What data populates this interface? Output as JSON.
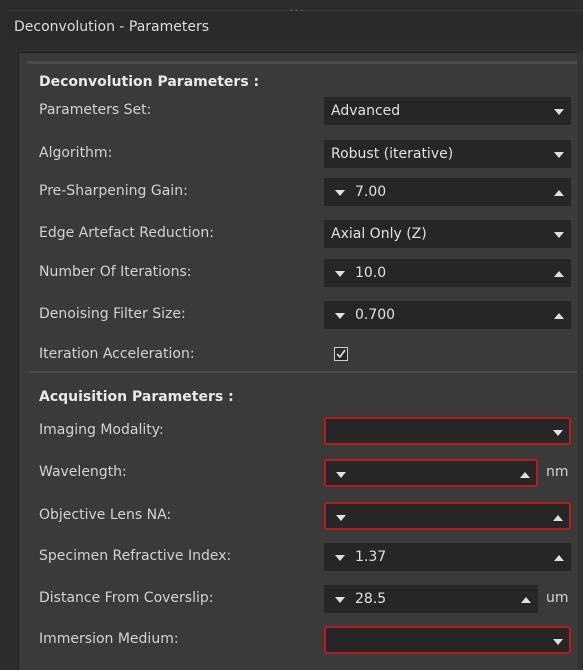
{
  "window": {
    "title": "Deconvolution - Parameters"
  },
  "deconvolution": {
    "section_title": "Deconvolution Parameters :",
    "parameters_set": {
      "label": "Parameters Set:",
      "value": "Advanced"
    },
    "algorithm": {
      "label": "Algorithm:",
      "value": "Robust (iterative)"
    },
    "pre_sharpening_gain": {
      "label": "Pre-Sharpening Gain:",
      "value": "7.00"
    },
    "edge_artefact_reduction": {
      "label": "Edge Artefact Reduction:",
      "value": "Axial Only (Z)"
    },
    "number_of_iterations": {
      "label": "Number Of Iterations:",
      "value": "10.0"
    },
    "denoising_filter_size": {
      "label": "Denoising Filter Size:",
      "value": "0.700"
    },
    "iteration_acceleration": {
      "label": "Iteration Acceleration:",
      "checked": true
    }
  },
  "acquisition": {
    "section_title": "Acquisition Parameters :",
    "imaging_modality": {
      "label": "Imaging Modality:",
      "value": ""
    },
    "wavelength": {
      "label": "Wavelength:",
      "value": "",
      "unit": "nm"
    },
    "objective_lens_na": {
      "label": "Objective Lens NA:",
      "value": ""
    },
    "specimen_refractive_index": {
      "label": "Specimen Refractive Index:",
      "value": "1.37"
    },
    "distance_from_coverslip": {
      "label": "Distance From Coverslip:",
      "value": "28.5",
      "unit": "um"
    },
    "immersion_medium": {
      "label": "Immersion Medium:",
      "value": ""
    }
  },
  "colors": {
    "error_border": "#b51d1d",
    "field_bg": "#262626",
    "panel_bg": "#3a3a3a"
  },
  "icons": [
    "dropdown-arrow-icon",
    "spin-down-icon",
    "spin-up-icon",
    "checkmark-icon"
  ]
}
